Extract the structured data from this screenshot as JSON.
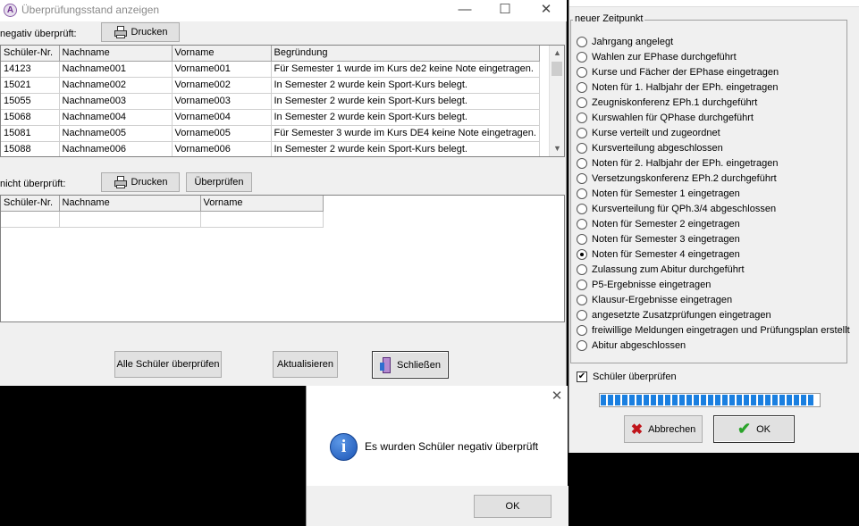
{
  "main_window": {
    "title": "Überprüfungsstand anzeigen",
    "app_icon_letter": "A",
    "controls": {
      "minimize": "—",
      "maximize": "☐",
      "close": "✕"
    }
  },
  "negative": {
    "label": "negativ überprüft:",
    "print_button": "Drucken",
    "columns": [
      "Schüler-Nr.",
      "Nachname",
      "Vorname",
      "Begründung"
    ],
    "rows": [
      [
        "14123",
        "Nachname001",
        "Vorname001",
        "Für Semester 1 wurde im Kurs de2 keine Note eingetragen."
      ],
      [
        "15021",
        "Nachname002",
        "Vorname002",
        "In Semester 2 wurde kein Sport-Kurs belegt."
      ],
      [
        "15055",
        "Nachname003",
        "Vorname003",
        "In Semester 2 wurde kein Sport-Kurs belegt."
      ],
      [
        "15068",
        "Nachname004",
        "Vorname004",
        "In Semester 2 wurde kein Sport-Kurs belegt."
      ],
      [
        "15081",
        "Nachname005",
        "Vorname005",
        "Für Semester 3 wurde im Kurs DE4 keine Note eingetragen."
      ],
      [
        "15088",
        "Nachname006",
        "Vorname006",
        "In Semester 2 wurde kein Sport-Kurs belegt."
      ]
    ]
  },
  "unchecked": {
    "label": "nicht überprüft:",
    "print_button": "Drucken",
    "check_button": "Überprüfen",
    "columns": [
      "Schüler-Nr.",
      "Nachname",
      "Vorname"
    ]
  },
  "bottom_buttons": {
    "check_all": "Alle Schüler überprüfen",
    "refresh": "Aktualisieren",
    "close": "Schließen"
  },
  "zeitpunkt": {
    "legend": "neuer Zeitpunkt",
    "selected_index": 14,
    "options": [
      "Jahrgang angelegt",
      "Wahlen zur EPhase durchgeführt",
      "Kurse und Fächer der EPhase eingetragen",
      "Noten für 1. Halbjahr der EPh. eingetragen",
      "Zeugniskonferenz EPh.1 durchgeführt",
      "Kurswahlen für QPhase durchgeführt",
      "Kurse verteilt und zugeordnet",
      "Kursverteilung abgeschlossen",
      "Noten für 2. Halbjahr der EPh. eingetragen",
      "Versetzungskonferenz EPh.2 durchgeführt",
      "Noten für Semester 1 eingetragen",
      "Kursverteilung für QPh.3/4 abgeschlossen",
      "Noten für Semester 2 eingetragen",
      "Noten für Semester 3 eingetragen",
      "Noten für Semester 4 eingetragen",
      "Zulassung zum Abitur durchgeführt",
      "P5-Ergebnisse eingetragen",
      "Klausur-Ergebnisse eingetragen",
      "angesetzte Zusatzprüfungen eingetragen",
      "freiwillige Meldungen eingetragen und Prüfungsplan erstellt",
      "Abitur abgeschlossen"
    ]
  },
  "pruefen_checkbox": {
    "label": "Schüler überprüfen",
    "checked": true
  },
  "progress": {
    "fraction": 1.0
  },
  "right_buttons": {
    "cancel": "Abbrechen",
    "ok": "OK"
  },
  "message_box": {
    "text": "Es wurden Schüler negativ überprüft",
    "ok": "OK",
    "close": "✕",
    "icon": "info-icon"
  },
  "colors": {
    "progress": "#1a7fe0",
    "cancel_x": "#c0141a",
    "ok_check": "#2aa32a",
    "info": "#1b54b5"
  }
}
